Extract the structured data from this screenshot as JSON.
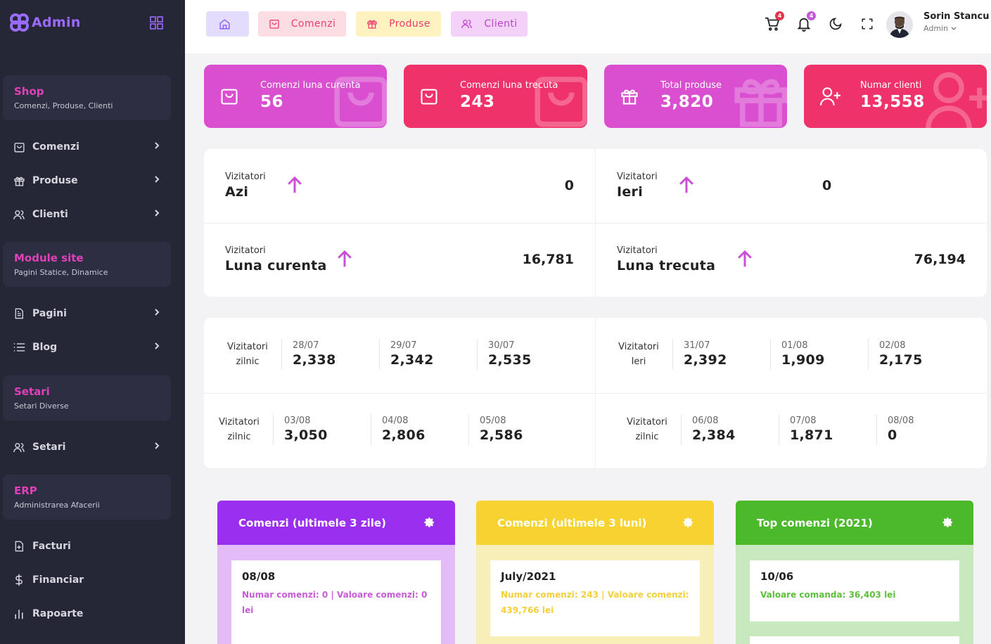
{
  "brand": {
    "name": "Admin"
  },
  "sidebar": {
    "sections": [
      {
        "title": "Shop",
        "subtitle": "Comenzi, Produse, Clienti"
      },
      {
        "title": "Module site",
        "subtitle": "Pagini Statice, Dinamice"
      },
      {
        "title": "Setari",
        "subtitle": "Setari Diverse"
      },
      {
        "title": "ERP",
        "subtitle": "Administrarea Afacerii"
      }
    ],
    "items": [
      {
        "label": "Comenzi",
        "icon": "shopping-bag-icon"
      },
      {
        "label": "Produse",
        "icon": "gift-icon"
      },
      {
        "label": "Clienti",
        "icon": "users-icon"
      },
      {
        "label": "Pagini",
        "icon": "file-icon"
      },
      {
        "label": "Blog",
        "icon": "list-icon"
      },
      {
        "label": "Setari",
        "icon": "users-icon"
      },
      {
        "label": "Facturi",
        "icon": "file-plus-icon"
      },
      {
        "label": "Financiar",
        "icon": "dollar-icon"
      },
      {
        "label": "Rapoarte",
        "icon": "bar-chart-icon"
      }
    ]
  },
  "topbar": {
    "buttons": [
      {
        "label": "",
        "icon": "home-icon"
      },
      {
        "label": "Comenzi",
        "icon": "shopping-bag-icon"
      },
      {
        "label": "Produse",
        "icon": "gift-icon"
      },
      {
        "label": "Clienti",
        "icon": "users-icon"
      }
    ],
    "cart_badge": "4",
    "bell_badge": "4",
    "user": {
      "name": "Sorin Stancu",
      "role": "Admin"
    }
  },
  "cards": [
    {
      "label": "Comenzi luna curenta",
      "value": "56",
      "color": "#d94fd0"
    },
    {
      "label": "Comenzi luna trecuta",
      "value": "243",
      "color": "#f0326a"
    },
    {
      "label": "Total produse",
      "value": "3,820",
      "color": "#d94fd0"
    },
    {
      "label": "Numar clienti",
      "value": "13,558",
      "color": "#f0326a"
    }
  ],
  "visitors": [
    {
      "small": "Vizitatori",
      "big": "Azi",
      "value": "0"
    },
    {
      "small": "Vizitatori",
      "big": "Ieri",
      "value": "0"
    },
    {
      "small": "Vizitatori",
      "big": "Luna curenta",
      "value": "16,781"
    },
    {
      "small": "Vizitatori",
      "big": "Luna trecuta",
      "value": "76,194"
    }
  ],
  "daily": {
    "row1_left": {
      "label1": "Vizitatori",
      "label2": "zilnic",
      "days": [
        {
          "date": "28/07",
          "value": "2,338"
        },
        {
          "date": "29/07",
          "value": "2,342"
        },
        {
          "date": "30/07",
          "value": "2,535"
        }
      ]
    },
    "row1_right": {
      "label1": "Vizitatori",
      "label2": "Ieri",
      "days": [
        {
          "date": "31/07",
          "value": "2,392"
        },
        {
          "date": "01/08",
          "value": "1,909"
        },
        {
          "date": "02/08",
          "value": "2,175"
        }
      ]
    },
    "row2_left": {
      "label1": "Vizitatori",
      "label2": "zilnic",
      "days": [
        {
          "date": "03/08",
          "value": "3,050"
        },
        {
          "date": "04/08",
          "value": "2,806"
        },
        {
          "date": "05/08",
          "value": "2,586"
        }
      ]
    },
    "row2_right": {
      "label1": "Vizitatori",
      "label2": "zilnic",
      "days": [
        {
          "date": "06/08",
          "value": "2,384"
        },
        {
          "date": "07/08",
          "value": "1,871"
        },
        {
          "date": "08/08",
          "value": "0"
        }
      ]
    }
  },
  "widgets": [
    {
      "title": "Comenzi (ultimele 3 zile)",
      "date": "08/08",
      "text": "Numar comenzi: 0 | Valoare comenzi: 0 lei",
      "head_color": "#9b2ff0",
      "body_color": "#e3bcf7",
      "text_color": "#c85bd8"
    },
    {
      "title": "Comenzi (ultimele 3 luni)",
      "date": "July/2021",
      "text": "Numar comenzi: 243 | Valoare comenzi: 439,766 lei",
      "head_color": "#f7d331",
      "body_color": "#f8eeb8",
      "text_color": "#f5cf3b"
    },
    {
      "title": "Top comenzi (2021)",
      "date": "10/06",
      "text": "Valoare comanda: 36,403 lei",
      "head_color": "#4cb82b",
      "body_color": "#c8e8bf",
      "text_color": "#5dbf3c"
    }
  ]
}
